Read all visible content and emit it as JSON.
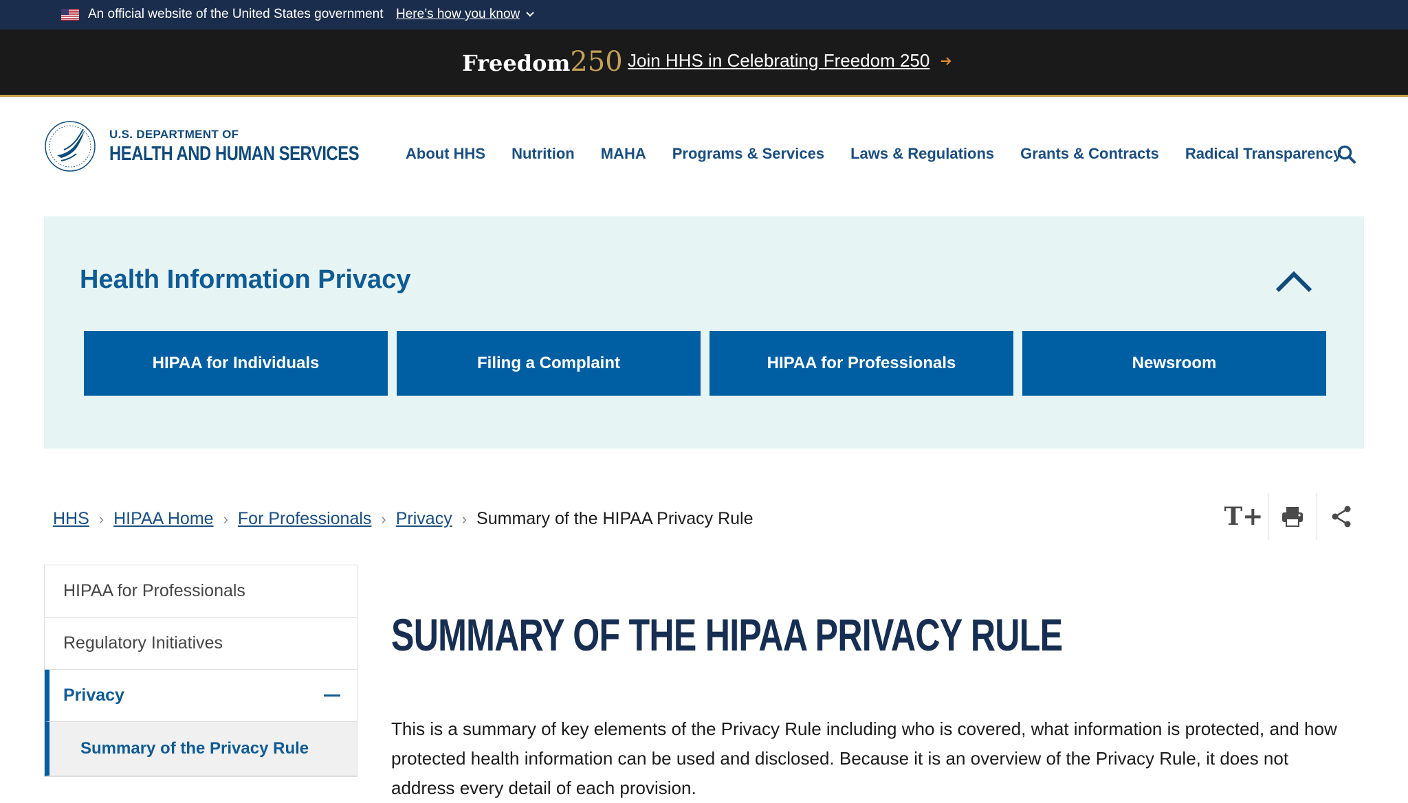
{
  "gov_banner": {
    "official_text": "An official website of the United States government",
    "how_link": "Here’s how you know"
  },
  "freedom": {
    "logo_word": "Freedom",
    "logo_num": "250",
    "link": "Join HHS in Celebrating Freedom 250"
  },
  "header": {
    "dept_line": "U.S. DEPARTMENT OF",
    "dept_name": "HEALTH AND HUMAN SERVICES",
    "nav": [
      "About HHS",
      "Nutrition",
      "MAHA",
      "Programs & Services",
      "Laws & Regulations",
      "Grants & Contracts",
      "Radical Transparency"
    ]
  },
  "hip": {
    "title": "Health Information Privacy",
    "buttons": [
      "HIPAA for Individuals",
      "Filing a Complaint",
      "HIPAA for Professionals",
      "Newsroom"
    ]
  },
  "breadcrumb": {
    "items": [
      "HHS",
      "HIPAA Home",
      "For Professionals",
      "Privacy"
    ],
    "current": "Summary of the HIPAA Privacy Rule"
  },
  "tools": {
    "text_size": "T+"
  },
  "sidenav": {
    "items": [
      "HIPAA for Professionals",
      "Regulatory Initiatives"
    ],
    "active": "Privacy",
    "sub": "Summary of the Privacy Rule"
  },
  "main": {
    "title": "SUMMARY OF THE HIPAA PRIVACY RULE",
    "intro": "This is a summary of key elements of the Privacy Rule including who is covered, what information is protected, and how protected health information can be used and disclosed. Because it is an overview of the Privacy Rule, it does not address every detail of each provision."
  },
  "colors": {
    "banner_bg": "#1b2d4d",
    "freedom_bg": "#1a1a1a",
    "brand_blue": "#005ea2",
    "panel_bg": "#e7f4f4",
    "title_navy": "#162e51"
  }
}
